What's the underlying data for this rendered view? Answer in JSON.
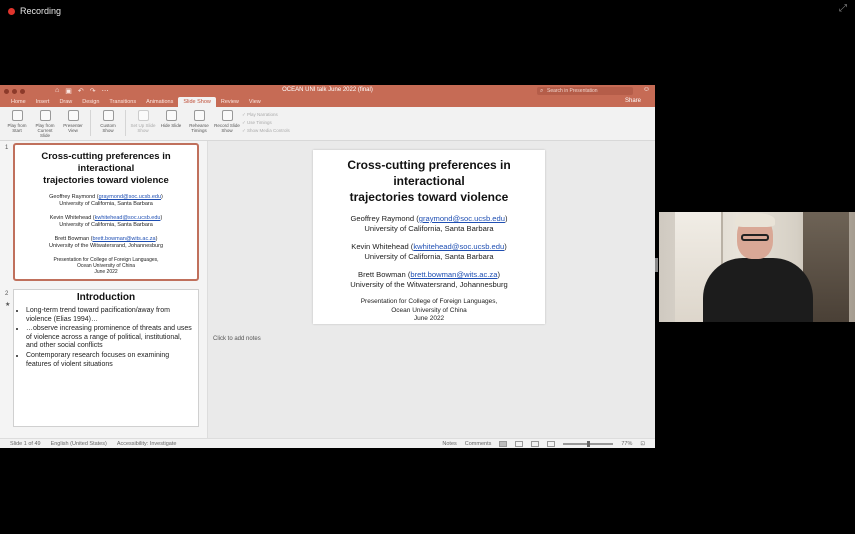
{
  "recording": {
    "label": "Recording"
  },
  "window": {
    "title": "OCEAN UNI talk June 2022 (final)",
    "search_placeholder": "Search in Presentation",
    "share_label": "Share"
  },
  "tabs": [
    "Home",
    "Insert",
    "Draw",
    "Design",
    "Transitions",
    "Animations",
    "Slide Show",
    "Review",
    "View"
  ],
  "active_tab": "Slide Show",
  "ribbon": {
    "buttons": [
      {
        "label": "Play from Start",
        "icon": "play-from-start-icon",
        "disabled": false
      },
      {
        "label": "Play from Current Slide",
        "icon": "play-current-icon",
        "disabled": false
      },
      {
        "label": "Presenter View",
        "icon": "presenter-view-icon",
        "disabled": false
      },
      {
        "label": "Custom Show",
        "icon": "custom-show-icon",
        "disabled": false
      },
      {
        "label": "Set Up Slide Show",
        "icon": "setup-icon",
        "disabled": true
      },
      {
        "label": "Hide Slide",
        "icon": "hide-slide-icon",
        "disabled": false
      },
      {
        "label": "Rehearse Timings",
        "icon": "rehearse-icon",
        "disabled": false
      },
      {
        "label": "Record Slide Show",
        "icon": "record-icon",
        "disabled": false
      }
    ],
    "checks": [
      "Play Narrations",
      "Use Timings",
      "Show Media Controls"
    ]
  },
  "slide1": {
    "title_line1": "Cross-cutting preferences in interactional",
    "title_line2": "trajectories toward violence",
    "author1_name": "Geoffrey Raymond (",
    "author1_email": "graymond@soc.ucsb.edu",
    "author1_close": ")",
    "author1_affil": "University of California, Santa Barbara",
    "author2_name": "Kevin Whitehead (",
    "author2_email": "kwhitehead@soc.ucsb.edu",
    "author2_close": ")",
    "author2_affil": "University of California, Santa Barbara",
    "author3_name": "Brett Bowman (",
    "author3_email": "brett.bowman@wits.ac.za",
    "author3_close": ")",
    "author3_affil": "University of the Witwatersrand, Johannesburg",
    "presentation_line1": "Presentation for College of Foreign Languages,",
    "presentation_line2": "Ocean University of China",
    "date": "June 2022"
  },
  "slide2": {
    "number": "2",
    "star": "★",
    "title": "Introduction",
    "bullets": [
      "Long-term trend toward pacification/away from violence (Elias 1994)…",
      "…observe increasing prominence of threats and uses of violence across a range of political, institutional, and other social conflicts",
      "Contemporary research focuses on examining features of violent situations"
    ]
  },
  "thumb1_number": "1",
  "notes_placeholder": "Click to add notes",
  "status": {
    "slide_counter": "Slide 1 of 49",
    "language": "English (United States)",
    "accessibility": "Accessibility: Investigate",
    "notes": "Notes",
    "comments": "Comments",
    "zoom": "77%"
  },
  "colors": {
    "accent": "#c66b55",
    "link": "#1f4fb3"
  }
}
